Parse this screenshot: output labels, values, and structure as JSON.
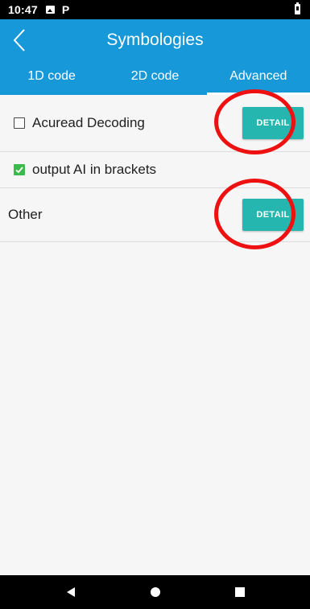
{
  "status_bar": {
    "time": "10:47",
    "icons": [
      "image-icon",
      "parking-icon",
      "battery-icon"
    ],
    "p_glyph": "P"
  },
  "app_bar": {
    "title": "Symbologies",
    "back_icon": "back-chevron-icon",
    "color": "#1798d8"
  },
  "tabs": [
    {
      "label": "1D code",
      "active": false
    },
    {
      "label": "2D code",
      "active": false
    },
    {
      "label": "Advanced",
      "active": true
    }
  ],
  "rows": [
    {
      "label": "Acuread Decoding",
      "checkbox": "unchecked",
      "button": "DETAIL"
    },
    {
      "label": "output AI in brackets",
      "checkbox": "checked"
    },
    {
      "label": "Other",
      "button": "DETAIL"
    }
  ],
  "colors": {
    "accent": "#1798d8",
    "button": "#26b6b0",
    "checkbox_checked": "#3dba4e",
    "annotation": "#ee1111"
  },
  "nav_bar": {
    "icons": [
      "back-triangle-icon",
      "home-circle-icon",
      "recents-square-icon"
    ]
  }
}
